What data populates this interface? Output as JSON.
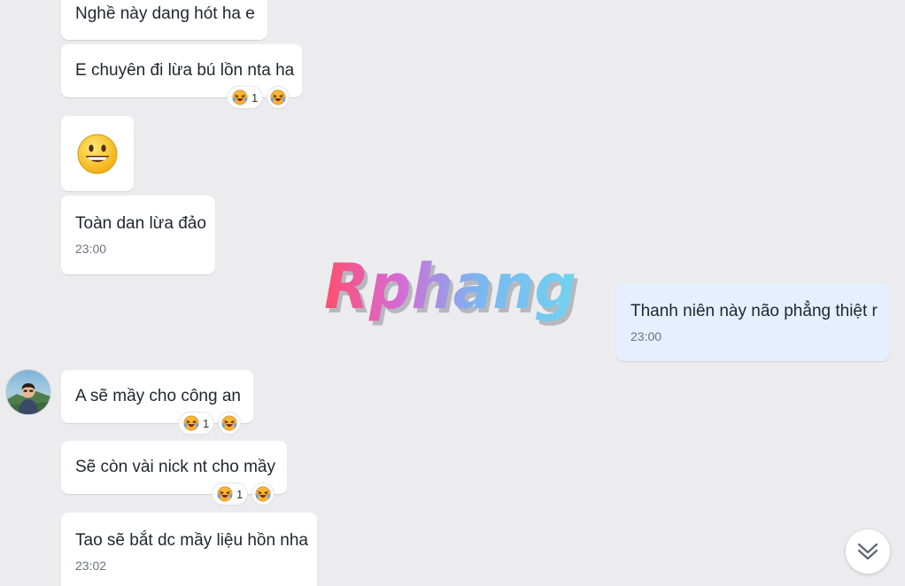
{
  "watermark": {
    "text": "Rphang"
  },
  "messages": [
    {
      "text": "Nghề này dang hót ha e"
    },
    {
      "text": "E chuyên đi lừa bú lồn nta ha",
      "reaction_count": "1"
    },
    {
      "emoji": "😀"
    },
    {
      "text": "Toàn dan lừa đảo",
      "time": "23:00"
    },
    {
      "text": "Thanh niên này não phẳng thiệt r",
      "time": "23:00"
    },
    {
      "text": "A sẽ mầy cho công an",
      "reaction_count": "1"
    },
    {
      "text": "Sẽ còn vài nick nt cho mầy",
      "reaction_count": "1"
    },
    {
      "text": "Tao sẽ bắt dc mầy liệu hồn nha",
      "time": "23:02"
    }
  ],
  "icons": {
    "reaction": "laughing-tears-icon",
    "scroll": "double-chevron-down-icon",
    "avatar": "contact-avatar"
  },
  "colors": {
    "background": "#ececef",
    "incoming_bubble": "#ffffff",
    "outgoing_bubble": "#e5efff",
    "time_text": "#6b7480"
  }
}
